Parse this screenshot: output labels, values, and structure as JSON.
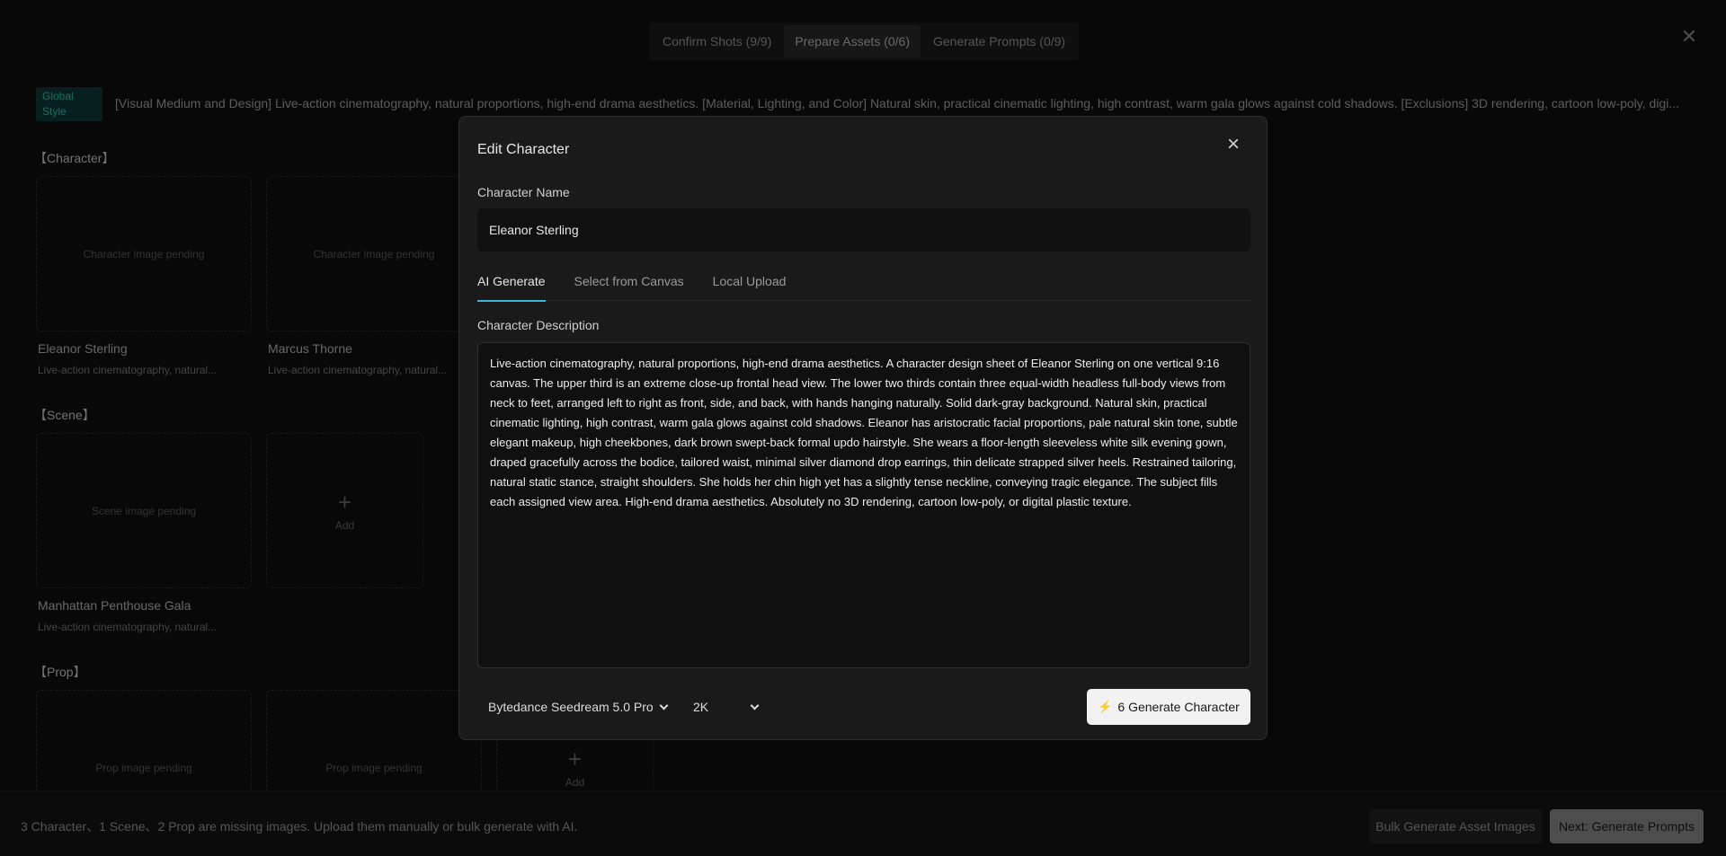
{
  "steps": [
    "Confirm Shots (9/9)",
    "Prepare Assets (0/6)",
    "Generate Prompts (0/9)"
  ],
  "global_style": {
    "badge": "Global Style",
    "text": "[Visual Medium and Design] Live-action cinematography, natural proportions, high-end drama aesthetics. [Material, Lighting, and Color] Natural skin, practical cinematic lighting, high contrast, warm gala glows against cold shadows. [Exclusions] 3D rendering, cartoon low-poly, digi..."
  },
  "sections": {
    "character": "【Character】",
    "scene": "【Scene】",
    "prop": "【Prop】"
  },
  "characters": [
    {
      "placeholder": "Character image pending",
      "name": "Eleanor Sterling",
      "desc": "Live-action cinematography, natural..."
    },
    {
      "placeholder": "Character image pending",
      "name": "Marcus Thorne",
      "desc": "Live-action cinematography, natural..."
    }
  ],
  "scenes": [
    {
      "placeholder": "Scene image pending",
      "name": "Manhattan Penthouse Gala",
      "desc": "Live-action cinematography, natural..."
    }
  ],
  "props": [
    {
      "placeholder": "Prop image pending"
    },
    {
      "placeholder": "Prop image pending"
    }
  ],
  "add_label": "Add",
  "bottom": {
    "message": "3 Character、1 Scene、2 Prop are missing images. Upload them manually or bulk generate with AI.",
    "bulk_button": "Bulk Generate Asset Images",
    "next_button": "Next: Generate Prompts"
  },
  "modal": {
    "title": "Edit Character",
    "name_label": "Character Name",
    "name_value": "Eleanor Sterling",
    "tabs": [
      "AI Generate",
      "Select from Canvas",
      "Local Upload"
    ],
    "active_tab": "AI Generate",
    "desc_label": "Character Description",
    "desc_value": "Live-action cinematography, natural proportions, high-end drama aesthetics. A character design sheet of Eleanor Sterling on one vertical 9:16 canvas. The upper third is an extreme close-up frontal head view. The lower two thirds contain three equal-width headless full-body views from neck to feet, arranged left to right as front, side, and back, with hands hanging naturally. Solid dark-gray background. Natural skin, practical cinematic lighting, high contrast, warm gala glows against cold shadows. Eleanor has aristocratic facial proportions, pale natural skin tone, subtle elegant makeup, high cheekbones, dark brown swept-back formal updo hairstyle. She wears a floor-length sleeveless white silk evening gown, draped gracefully across the bodice, tailored waist, minimal silver diamond drop earrings, thin delicate strapped silver heels. Restrained tailoring, natural static stance, straight shoulders. She holds her chin high yet has a slightly tense neckline, conveying tragic elegance. The subject fills each assigned view area. High-end drama aesthetics. Absolutely no 3D rendering, cartoon low-poly, or digital plastic texture.",
    "model_select": "Bytedance Seedream 5.0 Pro",
    "resolution_select": "2K",
    "generate_button": "6 Generate Character",
    "accent_color": "#3bb8d8"
  }
}
